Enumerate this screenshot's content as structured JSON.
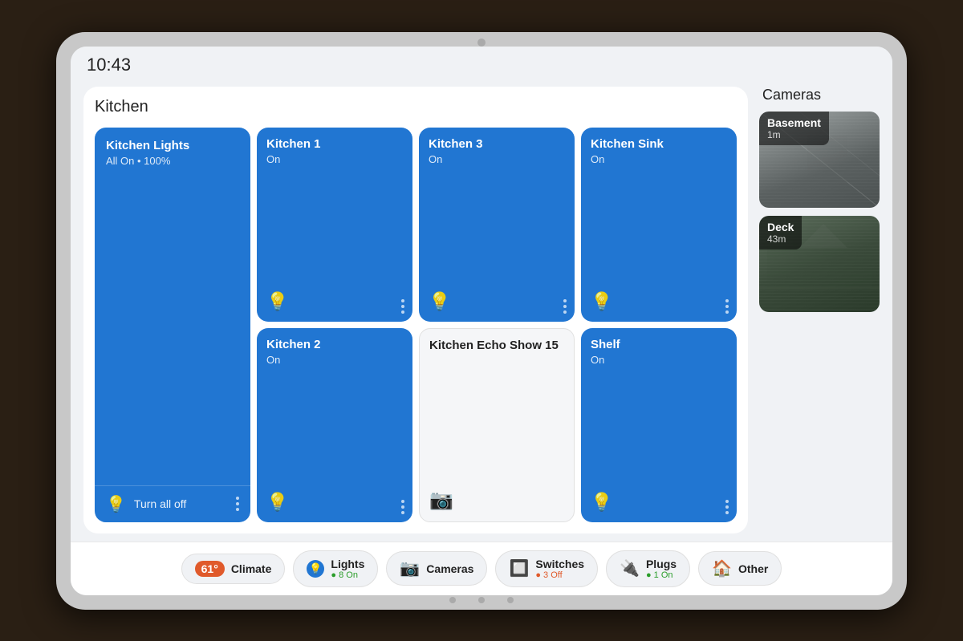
{
  "time": "10:43",
  "kitchen": {
    "title": "Kitchen",
    "all_lights": {
      "name": "Kitchen Lights",
      "status": "All On • 100%",
      "turn_off_label": "Turn all off"
    },
    "devices": [
      {
        "name": "Kitchen 1",
        "status": "On",
        "type": "light"
      },
      {
        "name": "Kitchen 3",
        "status": "On",
        "type": "light"
      },
      {
        "name": "Kitchen Sink",
        "status": "On",
        "type": "light"
      },
      {
        "name": "Kitchen 2",
        "status": "On",
        "type": "light"
      },
      {
        "name": "Kitchen Echo Show 15",
        "status": "",
        "type": "echo"
      },
      {
        "name": "Shelf",
        "status": "On",
        "type": "light"
      }
    ]
  },
  "cameras": {
    "title": "Cameras",
    "items": [
      {
        "name": "Basement",
        "time": "1m"
      },
      {
        "name": "Deck",
        "time": "43m"
      }
    ]
  },
  "bottom_nav": {
    "items": [
      {
        "id": "climate",
        "label": "Climate",
        "badge": "61°",
        "sublabel": ""
      },
      {
        "id": "lights",
        "label": "Lights",
        "sublabel": "8 On",
        "sublabel_color": "green"
      },
      {
        "id": "cameras",
        "label": "Cameras",
        "sublabel": ""
      },
      {
        "id": "switches",
        "label": "Switches",
        "sublabel": "3 Off",
        "sublabel_color": "red"
      },
      {
        "id": "plugs",
        "label": "Plugs",
        "sublabel": "1 On",
        "sublabel_color": "green"
      },
      {
        "id": "other",
        "label": "Other",
        "sublabel": ""
      }
    ]
  }
}
